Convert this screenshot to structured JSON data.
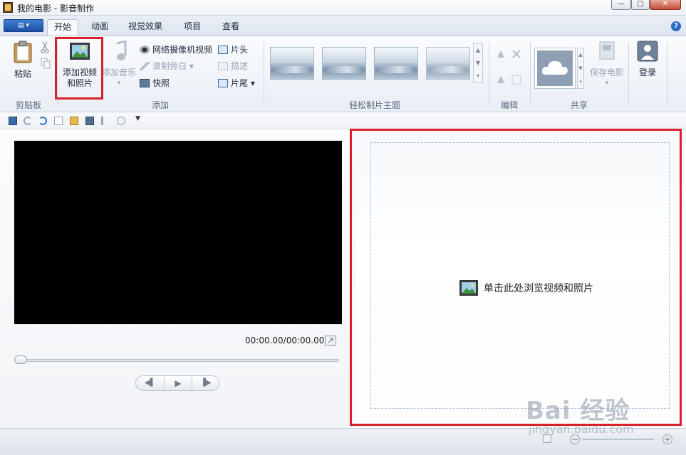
{
  "window": {
    "title": "我的电影 - 影音制作",
    "minimize": "—",
    "maximize": "□",
    "close": "✕"
  },
  "tabs": [
    {
      "label": "开始",
      "active": true
    },
    {
      "label": "动画",
      "active": false
    },
    {
      "label": "视觉效果",
      "active": false
    },
    {
      "label": "项目",
      "active": false
    },
    {
      "label": "查看",
      "active": false
    }
  ],
  "app_menu": "▤ ▾",
  "help": "?",
  "ribbon": {
    "clipboard": {
      "paste": "粘贴",
      "group_label": "剪贴板"
    },
    "add": {
      "add_videos_photos": [
        "添加视频",
        "和照片"
      ],
      "add_music": "添加音乐",
      "webcam_video": "网络摄像机视频",
      "record_narration": "录制旁白",
      "snapshot": "快照",
      "title": "片头",
      "caption": "描述",
      "credits": "片尾",
      "group_label": "添加"
    },
    "autothemes": {
      "group_label": "轻松制片主题"
    },
    "editing": {
      "group_label": "编辑"
    },
    "sharing": {
      "save_movie": "保存电影",
      "group_label": "共享"
    },
    "sign_in": "登录"
  },
  "preview": {
    "time": "00:00.00/00:00.00"
  },
  "storyboard": {
    "browse_text": "单击此处浏览视频和照片"
  },
  "watermark": {
    "brand": "Bai 经验",
    "url": "jingyan.baidu.com"
  },
  "colors": {
    "highlight": "#d9202a",
    "accent": "#1c4fa3"
  }
}
